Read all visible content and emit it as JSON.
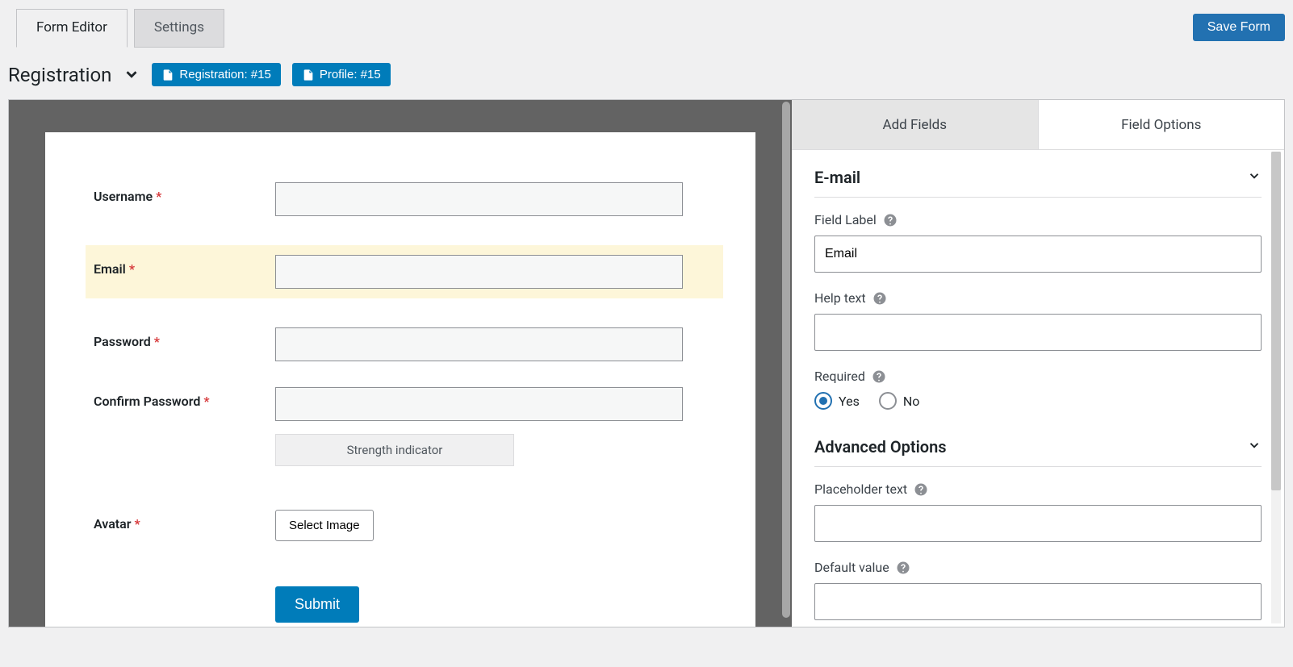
{
  "header": {
    "tabs": {
      "form_editor": "Form Editor",
      "settings": "Settings"
    },
    "save_button": "Save Form"
  },
  "toolbar": {
    "title": "Registration",
    "badges": {
      "registration": "Registration: #15",
      "profile": "Profile: #15"
    }
  },
  "form_preview": {
    "fields": {
      "username": {
        "label": "Username"
      },
      "email": {
        "label": "Email"
      },
      "password": {
        "label": "Password"
      },
      "confirm_password": {
        "label": "Confirm Password"
      },
      "strength": "Strength indicator",
      "avatar": {
        "label": "Avatar",
        "button": "Select Image"
      }
    },
    "submit": "Submit"
  },
  "sidebar": {
    "tabs": {
      "add_fields": "Add Fields",
      "field_options": "Field Options"
    },
    "section_email": "E-mail",
    "field_label": {
      "label": "Field Label",
      "value": "Email"
    },
    "help_text": {
      "label": "Help text",
      "value": ""
    },
    "required": {
      "label": "Required",
      "yes": "Yes",
      "no": "No"
    },
    "section_advanced": "Advanced Options",
    "placeholder_text": {
      "label": "Placeholder text",
      "value": ""
    },
    "default_value": {
      "label": "Default value",
      "value": ""
    }
  }
}
